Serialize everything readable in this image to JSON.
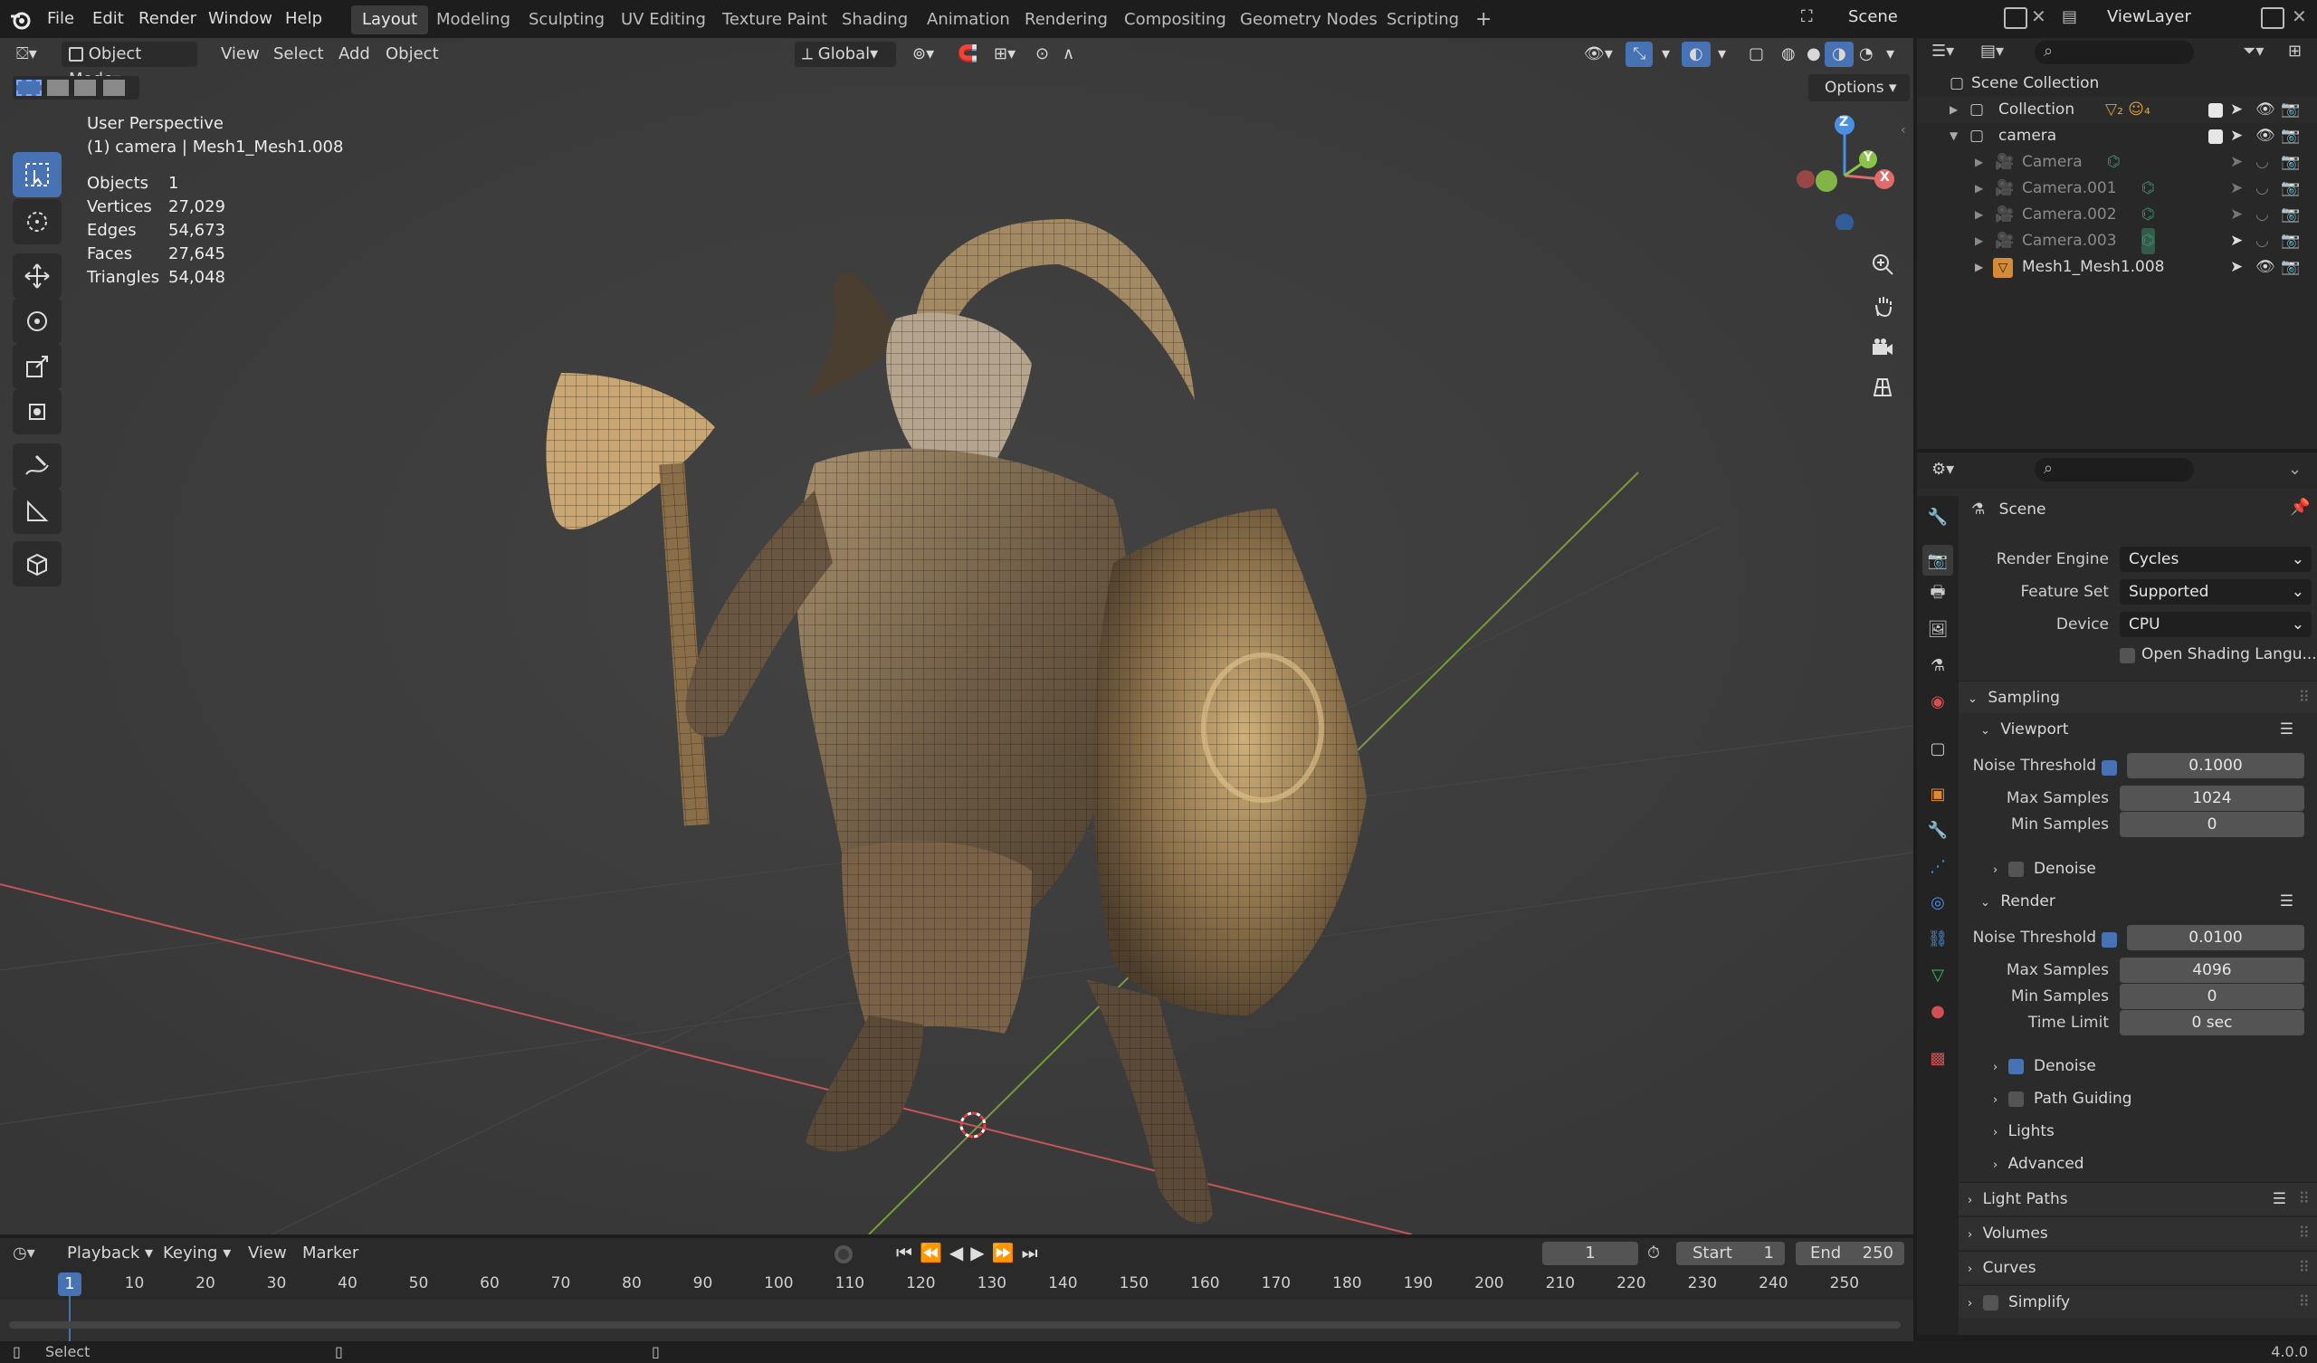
{
  "topbar": {
    "menus": [
      "File",
      "Edit",
      "Render",
      "Window",
      "Help"
    ],
    "workspaces": [
      "Layout",
      "Modeling",
      "Sculpting",
      "UV Editing",
      "Texture Paint",
      "Shading",
      "Animation",
      "Rendering",
      "Compositing",
      "Geometry Nodes",
      "Scripting"
    ],
    "active_workspace": "Layout",
    "scene_name": "Scene",
    "view_layer": "ViewLayer"
  },
  "viewport": {
    "mode": "Object Mode",
    "menus": [
      "View",
      "Select",
      "Add",
      "Object"
    ],
    "transform_orientation": "Global",
    "options_label": "Options",
    "overlay_title": "User Perspective",
    "overlay_subtitle": "(1) camera | Mesh1_Mesh1.008",
    "stats": [
      {
        "label": "Objects",
        "value": "1"
      },
      {
        "label": "Vertices",
        "value": "27,029"
      },
      {
        "label": "Edges",
        "value": "54,673"
      },
      {
        "label": "Faces",
        "value": "27,645"
      },
      {
        "label": "Triangles",
        "value": "54,048"
      }
    ],
    "gizmo": {
      "z": "Z",
      "y": "Y",
      "x": "X"
    }
  },
  "outliner": {
    "root": "Scene Collection",
    "items": [
      {
        "label": "Collection",
        "level": 0,
        "type": "collection"
      },
      {
        "label": "camera",
        "level": 0,
        "type": "collection"
      },
      {
        "label": "Camera",
        "level": 1,
        "type": "camera"
      },
      {
        "label": "Camera.001",
        "level": 1,
        "type": "camera"
      },
      {
        "label": "Camera.002",
        "level": 1,
        "type": "camera"
      },
      {
        "label": "Camera.003",
        "level": 1,
        "type": "camera"
      },
      {
        "label": "Mesh1_Mesh1.008",
        "level": 1,
        "type": "mesh"
      }
    ]
  },
  "properties": {
    "context": "Scene",
    "render_engine_label": "Render Engine",
    "render_engine": "Cycles",
    "feature_set_label": "Feature Set",
    "feature_set": "Supported",
    "device_label": "Device",
    "device": "CPU",
    "osl_label": "Open Shading Langu...",
    "sampling": "Sampling",
    "viewport": "Viewport",
    "render": "Render",
    "noise_threshold_label": "Noise Threshold",
    "max_samples_label": "Max Samples",
    "min_samples_label": "Min Samples",
    "time_limit_label": "Time Limit",
    "viewport_noise_threshold": "0.1000",
    "viewport_max_samples": "1024",
    "viewport_min_samples": "0",
    "render_noise_threshold": "0.0100",
    "render_max_samples": "4096",
    "render_min_samples": "0",
    "render_time_limit": "0 sec",
    "denoise": "Denoise",
    "path_guiding": "Path Guiding",
    "lights": "Lights",
    "advanced": "Advanced",
    "light_paths": "Light Paths",
    "volumes": "Volumes",
    "curves": "Curves",
    "simplify": "Simplify"
  },
  "timeline": {
    "menus": [
      "Playback",
      "Keying",
      "View",
      "Marker"
    ],
    "current_frame": "1",
    "start_label": "Start",
    "start": "1",
    "end_label": "End",
    "end": "250",
    "ticks": [
      "10",
      "20",
      "30",
      "40",
      "50",
      "60",
      "70",
      "80",
      "90",
      "100",
      "110",
      "120",
      "130",
      "140",
      "150",
      "160",
      "170",
      "180",
      "190",
      "200",
      "210",
      "220",
      "230",
      "240",
      "250"
    ]
  },
  "status": {
    "left": "Select",
    "version": "4.0.0"
  },
  "colors": {
    "accent": "#4772b3",
    "x_axis": "#e06b6b",
    "y_axis": "#8bc34a",
    "z_axis": "#4a90e2"
  }
}
